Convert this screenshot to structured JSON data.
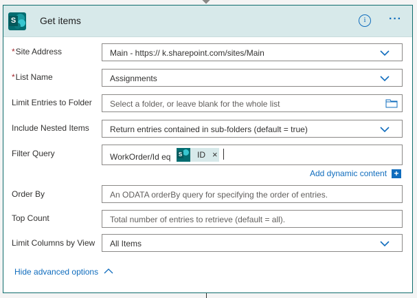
{
  "card": {
    "title": "Get items",
    "logo_letter": "S",
    "more_label": "···"
  },
  "fields": {
    "site_address": {
      "required_mark": "*",
      "label": "Site Address",
      "value": "Main - https://          k.sharepoint.com/sites/Main"
    },
    "list_name": {
      "required_mark": "*",
      "label": "List Name",
      "value": "Assignments"
    },
    "limit_folder": {
      "label": "Limit Entries to Folder",
      "placeholder": "Select a folder, or leave blank for the whole list"
    },
    "nested_items": {
      "label": "Include Nested Items",
      "value": "Return entries contained in sub-folders (default = true)"
    },
    "filter_query": {
      "label": "Filter Query",
      "text": "WorkOrder/Id eq",
      "token_label": "ID",
      "token_close": "×"
    },
    "order_by": {
      "label": "Order By",
      "placeholder": "An ODATA orderBy query for specifying the order of entries."
    },
    "top_count": {
      "label": "Top Count",
      "placeholder": "Total number of entries to retrieve (default = all)."
    },
    "limit_columns": {
      "label": "Limit Columns by View",
      "value": "All Items"
    }
  },
  "actions": {
    "add_dynamic": "Add dynamic content",
    "add_dynamic_plus": "+",
    "hide_advanced": "Hide advanced options"
  },
  "colors": {
    "accent": "#0f6cbd",
    "header_bg": "#d7e9ea",
    "sharepoint_teal": "#036c70",
    "required": "#a4262c"
  }
}
